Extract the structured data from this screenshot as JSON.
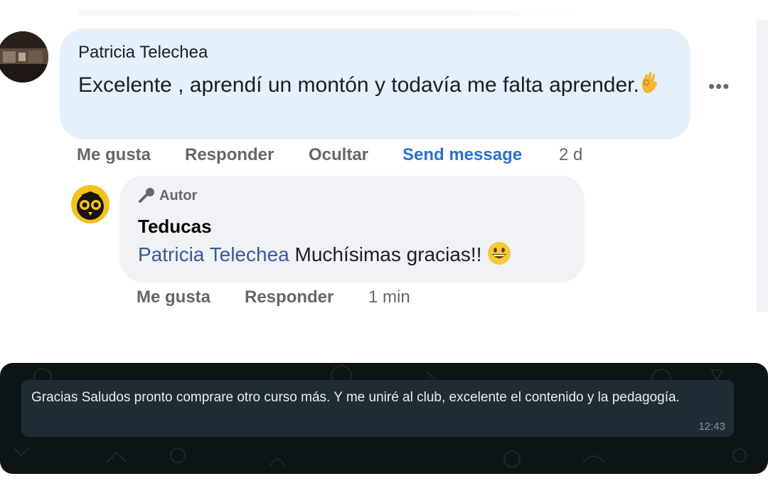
{
  "main_comment": {
    "author": "Patricia Telechea",
    "text": "Excelente , aprendí un montón y todavía me falta aprender.",
    "emoji_icon": "ok-hand-icon",
    "actions": {
      "like": "Me gusta",
      "reply": "Responder",
      "hide": "Ocultar",
      "send_message": "Send message",
      "time": "2 d"
    },
    "more_icon": "•••"
  },
  "reply_comment": {
    "badge": "Autor",
    "author": "Teducas",
    "mention": "Patricia Telechea",
    "text": "Muchísimas gracias!!",
    "emoji_icon": "grinning-face-icon",
    "actions": {
      "like": "Me gusta",
      "reply": "Responder",
      "time": "1 min"
    }
  },
  "whatsapp_message": {
    "text": "Gracias Saludos pronto comprare otro curso más. Y me uniré al club, excelente el contenido  y la pedagogía.",
    "time": "12:43"
  },
  "colors": {
    "comment_bubble": "#e4f0fb",
    "reply_bubble": "#f0f2f5",
    "link_blue": "#2a72d0",
    "mention_blue": "#385898",
    "wa_background": "#0e1518",
    "wa_bubble": "#202c33"
  }
}
